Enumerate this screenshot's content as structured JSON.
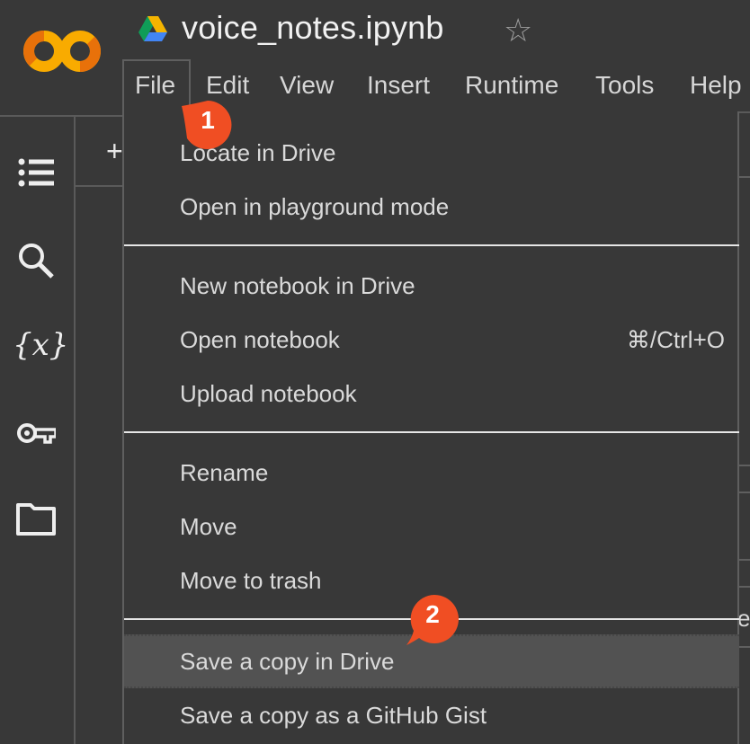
{
  "header": {
    "app_logo": "colab-logo",
    "drive_icon": "google-drive-icon",
    "title": "voice_notes.ipynb",
    "star_icon": "☆"
  },
  "menubar": [
    "File",
    "Edit",
    "View",
    "Insert",
    "Runtime",
    "Tools",
    "Help"
  ],
  "toolbar": {
    "add_label": "+"
  },
  "sidebar": {
    "icons": [
      "table-of-contents-icon",
      "search-icon",
      "variables-icon",
      "secrets-key-icon",
      "files-folder-icon"
    ],
    "variables_glyph": "{x}"
  },
  "file_menu": {
    "groups": [
      [
        {
          "label": "Locate in Drive"
        },
        {
          "label": "Open in playground mode"
        }
      ],
      [
        {
          "label": "New notebook in Drive"
        },
        {
          "label": "Open notebook",
          "shortcut": "⌘/Ctrl+O"
        },
        {
          "label": "Upload notebook"
        }
      ],
      [
        {
          "label": "Rename"
        },
        {
          "label": "Move"
        },
        {
          "label": "Move to trash"
        }
      ],
      [
        {
          "label": "Save a copy in Drive",
          "highlighted": true
        },
        {
          "label": "Save a copy as a GitHub Gist"
        }
      ]
    ]
  },
  "annotations": [
    {
      "number": "1",
      "color": "#f04e23"
    },
    {
      "number": "2",
      "color": "#f04e23"
    }
  ],
  "background_fragment": "es"
}
